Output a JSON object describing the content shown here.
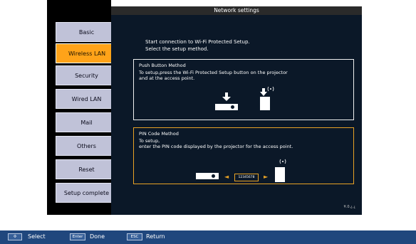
{
  "window": {
    "title": "Network settings"
  },
  "sidebar": {
    "items": [
      {
        "label": "Basic",
        "active": false
      },
      {
        "label": "Wireless LAN",
        "active": true
      },
      {
        "label": "Security",
        "active": false
      },
      {
        "label": "Wired LAN",
        "active": false
      },
      {
        "label": "Mail",
        "active": false
      },
      {
        "label": "Others",
        "active": false
      },
      {
        "label": "Reset",
        "active": false
      },
      {
        "label": "Setup complete",
        "active": false
      }
    ]
  },
  "main": {
    "intro_line1": "Start connection to Wi-Fi Protected Setup.",
    "intro_line2": "Select the setup method.",
    "push_box": {
      "title": "Push Button Method",
      "line1": "To setup,press the Wi-Fi Protected Setup button on the projector",
      "line2": "and at the access point."
    },
    "pin_box": {
      "title": "PIN Code Method",
      "line1": "To setup,",
      "line2": "enter the PIN code displayed by the projector for the access point.",
      "pin": "12345678"
    },
    "version": "¥.0.¿.¿"
  },
  "help_bar": {
    "select_key": "✣",
    "select_label": "Select",
    "enter_key": "Enter",
    "enter_label": "Done",
    "esc_key": "ESC",
    "esc_label": "Return"
  },
  "colors": {
    "accent": "#ffa319",
    "panel": "#0b1828",
    "pin_border": "#e8a225",
    "help_bar": "#20477d"
  }
}
